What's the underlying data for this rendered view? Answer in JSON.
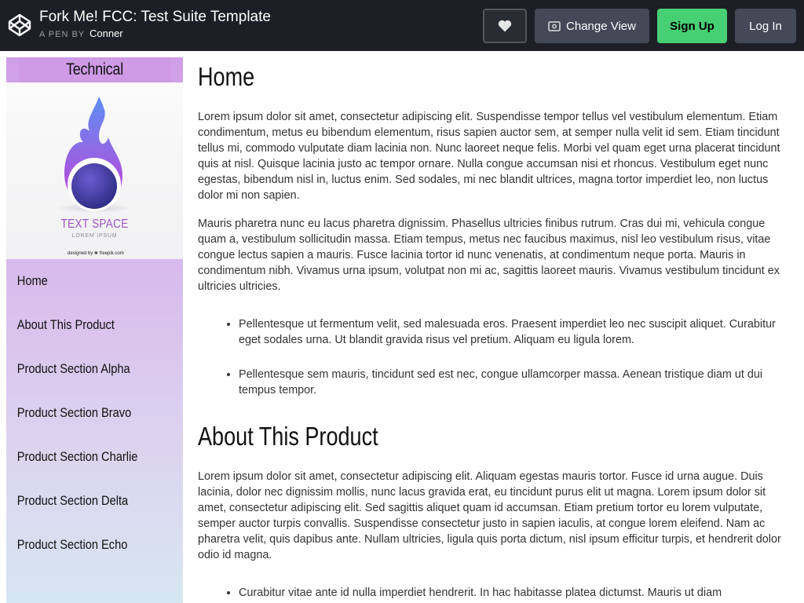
{
  "topbar": {
    "title": "Fork Me! FCC: Test Suite Template",
    "by_label": "A PEN BY",
    "author": "Conner",
    "change_view_label": "Change View",
    "signup_label": "Sign Up",
    "login_label": "Log In",
    "accent_color": "#47cf73"
  },
  "nav": {
    "header": "Technical Documentation",
    "image": {
      "text": "TEXT SPACE",
      "subtext": "LOREM IPSUM",
      "credit": "designed by ❀ freepik.com"
    },
    "items": [
      {
        "label": "Home"
      },
      {
        "label": "About This Product"
      },
      {
        "label": "Product Section Alpha"
      },
      {
        "label": "Product Section Bravo"
      },
      {
        "label": "Product Section Charlie"
      },
      {
        "label": "Product Section Delta"
      },
      {
        "label": "Product Section Echo"
      }
    ]
  },
  "sections": [
    {
      "title": "Home",
      "paragraphs": [
        "Lorem ipsum dolor sit amet, consectetur adipiscing elit. Suspendisse tempor tellus vel vestibulum elementum. Etiam condimentum, metus eu bibendum elementum, risus sapien auctor sem, at semper nulla velit id sem. Etiam tincidunt tellus mi, commodo vulputate diam lacinia non. Nunc laoreet neque felis. Morbi vel quam eget urna placerat tincidunt quis at nisl. Quisque lacinia justo ac tempor ornare. Nulla congue accumsan nisi et rhoncus. Vestibulum eget nunc egestas, bibendum nisl in, luctus enim. Sed sodales, mi nec blandit ultrices, magna tortor imperdiet leo, non luctus dolor mi non sapien.",
        "Mauris pharetra nunc eu lacus pharetra dignissim. Phasellus ultricies finibus rutrum. Cras dui mi, vehicula congue quam a, vestibulum sollicitudin massa. Etiam tempus, metus nec faucibus maximus, nisl leo vestibulum risus, vitae congue lectus sapien a mauris. Fusce lacinia tortor id nunc venenatis, at condimentum neque porta. Mauris in condimentum nibh. Vivamus urna ipsum, volutpat non mi ac, sagittis laoreet mauris. Vivamus vestibulum tincidunt ex ultricies ultricies."
      ],
      "bullets": [
        "Pellentesque ut fermentum velit, sed malesuada eros. Praesent imperdiet leo nec suscipit aliquet. Curabitur eget sodales urna. Ut blandit gravida risus vel pretium. Aliquam eu ligula lorem.",
        "Pellentesque sem mauris, tincidunt sed est nec, congue ullamcorper massa. Aenean tristique diam ut dui tempus tempor."
      ]
    },
    {
      "title": "About This Product",
      "paragraphs": [
        "Lorem ipsum dolor sit amet, consectetur adipiscing elit. Aliquam egestas mauris tortor. Fusce id urna augue. Duis lacinia, dolor nec dignissim mollis, nunc lacus gravida erat, eu tincidunt purus elit ut magna. Lorem ipsum dolor sit amet, consectetur adipiscing elit. Sed sagittis aliquet quam id accumsan. Etiam pretium tortor eu lorem vulputate, semper auctor turpis convallis. Suspendisse consectetur justo in sapien iaculis, at congue lorem eleifend. Nam ac pharetra velit, quis dapibus ante. Nullam ultricies, ligula quis porta dictum, nisl ipsum efficitur turpis, et hendrerit dolor odio id magna."
      ],
      "bullets": [
        "Curabitur vitae ante id nulla imperdiet hendrerit. In hac habitasse platea dictumst. Mauris ut diam"
      ]
    }
  ]
}
